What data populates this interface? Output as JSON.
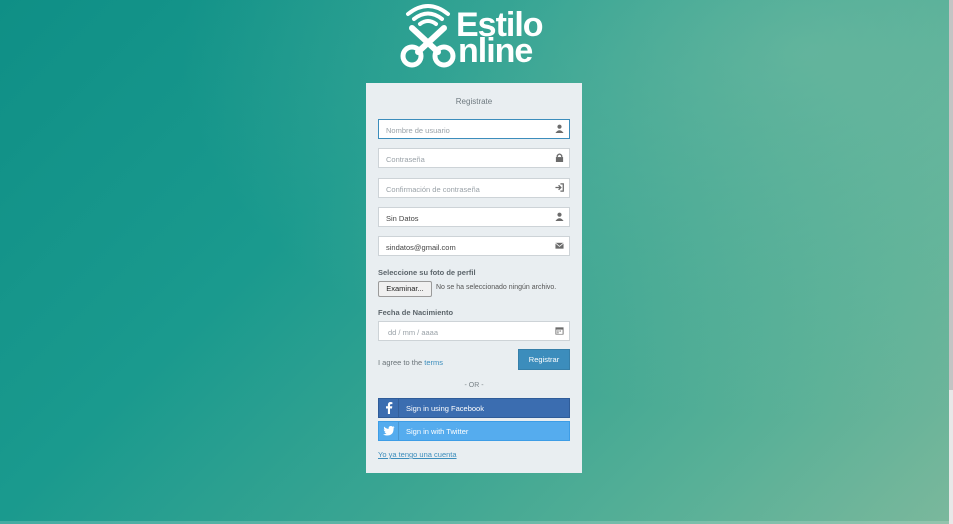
{
  "logo": {
    "line1": "Estilo",
    "line2": "nline"
  },
  "form": {
    "title": "Registrate",
    "username": {
      "placeholder": "Nombre de usuario",
      "value": ""
    },
    "password": {
      "placeholder": "Contraseña",
      "value": ""
    },
    "password_confirm": {
      "placeholder": "Confirmación de contraseña",
      "value": ""
    },
    "fullname": {
      "placeholder": "",
      "value": "Sin Datos"
    },
    "email": {
      "placeholder": "",
      "value": "sindatos@gmail.com"
    },
    "photo_label": "Seleccione su foto de perfil",
    "file_button": "Examinar...",
    "file_status": "No se ha seleccionado ningún archivo.",
    "birth_label": "Fecha de Nacimiento",
    "birth": {
      "placeholder": "dd / mm / aaaa"
    },
    "agree_prefix": "I agree to the ",
    "agree_link": "terms",
    "register_button": "Registrar",
    "or_divider": "- OR -",
    "facebook_button": "Sign in using Facebook",
    "twitter_button": "Sign in with Twitter",
    "have_account_link": "Yo ya tengo una cuenta"
  },
  "colors": {
    "accent": "#3c8dbc",
    "facebook": "#3b6db0",
    "twitter": "#55acee",
    "background_start": "#0f8f86",
    "background_end": "#7bb89c"
  },
  "icons": {
    "username": "user-icon",
    "password": "lock-icon",
    "password_confirm": "sign-in-icon",
    "fullname": "user-icon",
    "email": "envelope-icon",
    "birth": "calendar-icon"
  }
}
